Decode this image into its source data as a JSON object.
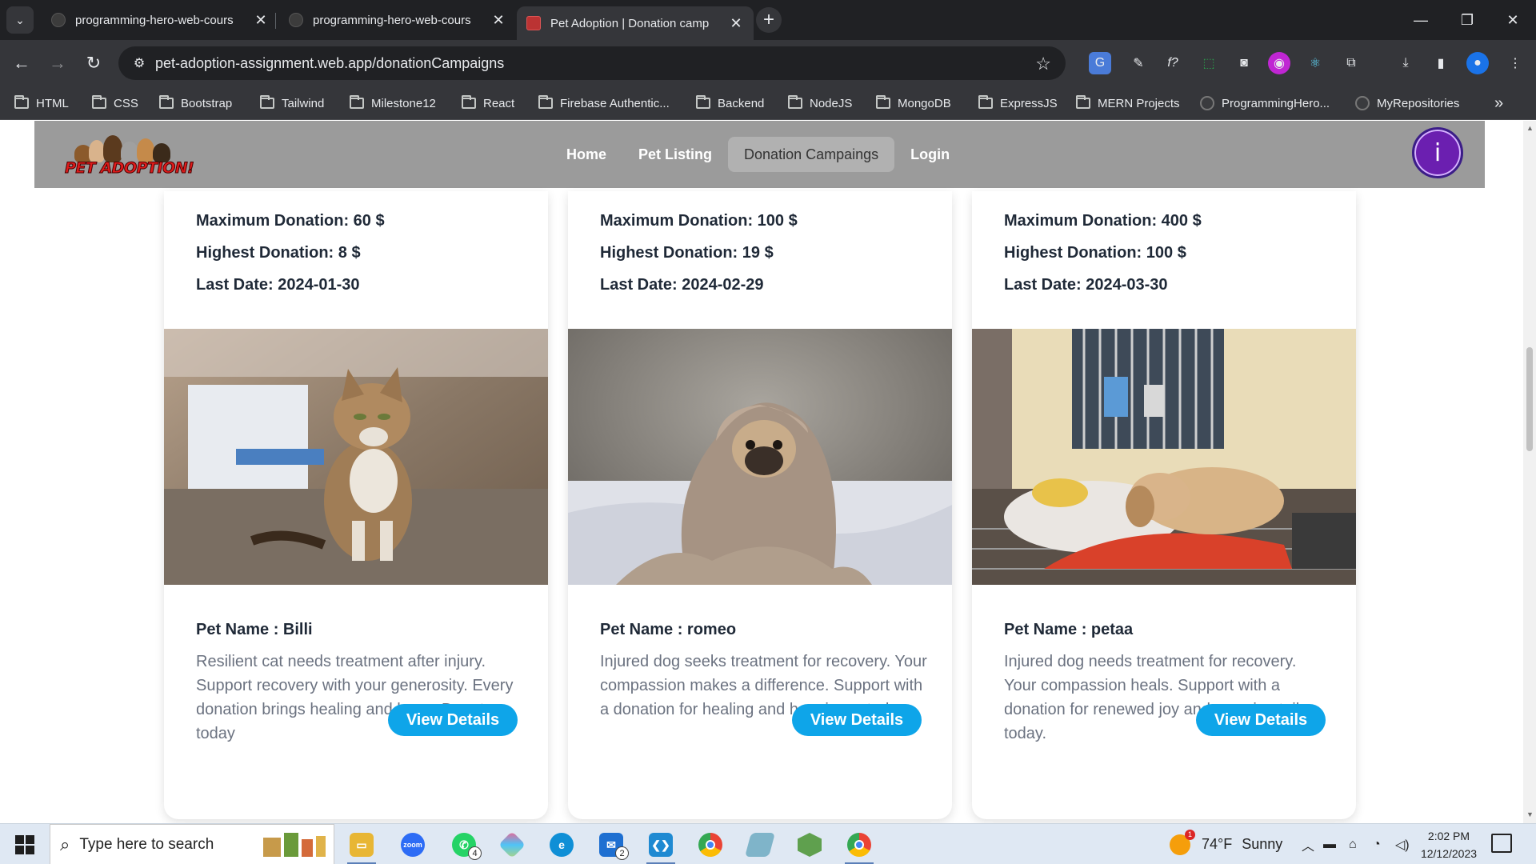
{
  "browser": {
    "tabs": [
      {
        "title": "programming-hero-web-cours",
        "active": false
      },
      {
        "title": "programming-hero-web-cours",
        "active": false
      },
      {
        "title": "Pet Adoption | Donation camp",
        "active": true
      }
    ],
    "url": "pet-adoption-assignment.web.app/donationCampaigns",
    "bookmarks": [
      {
        "label": "HTML",
        "type": "folder"
      },
      {
        "label": "CSS",
        "type": "folder"
      },
      {
        "label": "Bootstrap",
        "type": "folder"
      },
      {
        "label": "Tailwind",
        "type": "folder"
      },
      {
        "label": "Milestone12",
        "type": "folder"
      },
      {
        "label": "React",
        "type": "folder"
      },
      {
        "label": "Firebase Authentic...",
        "type": "folder"
      },
      {
        "label": "Backend",
        "type": "folder"
      },
      {
        "label": "NodeJS",
        "type": "folder"
      },
      {
        "label": "MongoDB",
        "type": "folder"
      },
      {
        "label": "ExpressJS",
        "type": "folder"
      },
      {
        "label": "MERN Projects",
        "type": "folder"
      },
      {
        "label": "ProgrammingHero...",
        "type": "github"
      },
      {
        "label": "MyRepositories",
        "type": "github"
      }
    ],
    "overflow_glyph": "»"
  },
  "site": {
    "logo_text": "PET ADOPTION!",
    "nav": [
      {
        "label": "Home",
        "active": false
      },
      {
        "label": "Pet Listing",
        "active": false
      },
      {
        "label": "Donation Campaings",
        "active": true
      },
      {
        "label": "Login",
        "active": false
      }
    ],
    "avatar_letter": "i",
    "accent": "#0ea5e9",
    "nav_bg": "#9b9b9b"
  },
  "cards": [
    {
      "max_donation": "Maximum Donation: 60 $",
      "highest_donation": "Highest Donation: 8 $",
      "last_date": "Last Date: 2024-01-30",
      "pet_name": "Pet Name : Billi",
      "description": "Resilient cat needs treatment after injury. Support recovery with your generosity. Every donation brings healing and hope. Donate today",
      "button": "View Details",
      "photo": "cat-photo"
    },
    {
      "max_donation": "Maximum Donation: 100 $",
      "highest_donation": "Highest Donation: 19 $",
      "last_date": "Last Date: 2024-02-29",
      "pet_name": "Pet Name : romeo",
      "description": "Injured dog seeks treatment for recovery. Your compassion makes a difference. Support with a donation for healing and happiness today.",
      "button": "View Details",
      "photo": "pug-blanket-photo"
    },
    {
      "max_donation": "Maximum Donation: 400 $",
      "highest_donation": "Highest Donation: 100 $",
      "last_date": "Last Date: 2024-03-30",
      "pet_name": "Pet Name : petaa",
      "description": "Injured dog needs treatment for recovery. Your compassion heals. Support with a donation for renewed joy and wagging tails today.",
      "button": "View Details",
      "photo": "puppy-cage-photo"
    }
  ],
  "taskbar": {
    "search_placeholder": "Type here to search",
    "apps": [
      {
        "name": "file-explorer-icon",
        "running": true
      },
      {
        "name": "zoom-icon",
        "label": "zoom",
        "running": false
      },
      {
        "name": "whatsapp-icon",
        "badge": "4",
        "running": false
      },
      {
        "name": "teams-app-icon",
        "running": false
      },
      {
        "name": "edge-icon",
        "running": false
      },
      {
        "name": "mail-icon",
        "badge": "2",
        "running": false
      },
      {
        "name": "vscode-icon",
        "running": true
      },
      {
        "name": "chrome-icon",
        "running": false
      },
      {
        "name": "app-icon",
        "running": false
      },
      {
        "name": "nodejs-icon",
        "running": false
      },
      {
        "name": "chrome-profile-icon",
        "running": true
      }
    ],
    "weather_temp": "74°F",
    "weather_desc": "Sunny",
    "weather_alert": "1",
    "time": "2:02 PM",
    "date": "12/12/2023"
  }
}
